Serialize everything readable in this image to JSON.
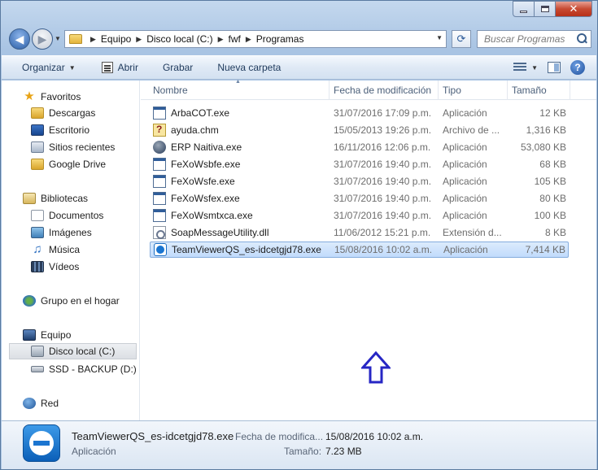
{
  "address": {
    "crumbs": [
      "Equipo",
      "Disco local (C:)",
      "fwf",
      "Programas"
    ],
    "search_placeholder": "Buscar Programas"
  },
  "toolbar": {
    "organize": "Organizar",
    "open": "Abrir",
    "burn": "Grabar",
    "new_folder": "Nueva carpeta"
  },
  "nav": {
    "favorites": "Favoritos",
    "downloads": "Descargas",
    "desktop": "Escritorio",
    "recent": "Sitios recientes",
    "gdrive": "Google Drive",
    "libraries": "Bibliotecas",
    "documents": "Documentos",
    "images": "Imágenes",
    "music": "Música",
    "videos": "Vídeos",
    "homegroup": "Grupo en el hogar",
    "computer": "Equipo",
    "local_disk": "Disco local (C:)",
    "ssd": "SSD - BACKUP (D:)",
    "network": "Red"
  },
  "columns": {
    "name": "Nombre",
    "modified": "Fecha de modificación",
    "type": "Tipo",
    "size": "Tamaño"
  },
  "files": [
    {
      "name": "ArbaCOT.exe",
      "date": "31/07/2016 17:09 p.m.",
      "type": "Aplicación",
      "size": "12 KB",
      "icon": "app-icon"
    },
    {
      "name": "ayuda.chm",
      "date": "15/05/2013 19:26 p.m.",
      "type": "Archivo de ...",
      "size": "1,316 KB",
      "icon": "help-file-icon"
    },
    {
      "name": "ERP Naitiva.exe",
      "date": "16/11/2016 12:06 p.m.",
      "type": "Aplicación",
      "size": "53,080 KB",
      "icon": "erp-app-icon"
    },
    {
      "name": "FeXoWsbfe.exe",
      "date": "31/07/2016 19:40 p.m.",
      "type": "Aplicación",
      "size": "68 KB",
      "icon": "app-icon"
    },
    {
      "name": "FeXoWsfe.exe",
      "date": "31/07/2016 19:40 p.m.",
      "type": "Aplicación",
      "size": "105 KB",
      "icon": "app-icon"
    },
    {
      "name": "FeXoWsfex.exe",
      "date": "31/07/2016 19:40 p.m.",
      "type": "Aplicación",
      "size": "80 KB",
      "icon": "app-icon"
    },
    {
      "name": "FeXoWsmtxca.exe",
      "date": "31/07/2016 19:40 p.m.",
      "type": "Aplicación",
      "size": "100 KB",
      "icon": "app-icon"
    },
    {
      "name": "SoapMessageUtility.dll",
      "date": "11/06/2012 15:21 p.m.",
      "type": "Extensión d...",
      "size": "8 KB",
      "icon": "dll-icon"
    },
    {
      "name": "TeamViewerQS_es-idcetgjd78.exe",
      "date": "15/08/2016 10:02 a.m.",
      "type": "Aplicación",
      "size": "7,414 KB",
      "icon": "teamviewer-icon",
      "selected": true
    }
  ],
  "details": {
    "name": "TeamViewerQS_es-idcetgjd78.exe",
    "type": "Aplicación",
    "modified_label": "Fecha de modifica...",
    "modified_value": "15/08/2016 10:02 a.m.",
    "size_label": "Tamaño:",
    "size_value": "7.23 MB"
  }
}
